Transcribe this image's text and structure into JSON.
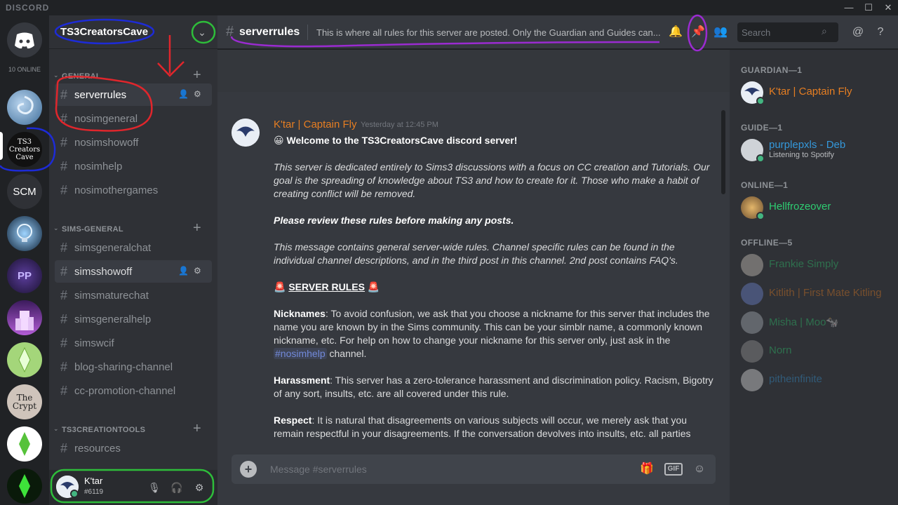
{
  "app": {
    "logo_text": "DISCORD"
  },
  "window_controls": {
    "minimize": "—",
    "maximize": "☐",
    "close": "✕"
  },
  "guilds": {
    "online_count": "10 ONLINE",
    "items": [
      {
        "name": "Discord Home",
        "label": ""
      },
      {
        "name": "Guild Blue Swirl",
        "label": ""
      },
      {
        "name": "TS3CreatorsCave",
        "label": "TS3 Creators Cave"
      },
      {
        "name": "SCM",
        "label": "SCM"
      },
      {
        "name": "Guild Lightbulb",
        "label": ""
      },
      {
        "name": "Guild PP",
        "label": "PP"
      },
      {
        "name": "Guild Castle",
        "label": ""
      },
      {
        "name": "Guild Plumbob Green",
        "label": ""
      },
      {
        "name": "The Crypt",
        "label": "The Crypt"
      },
      {
        "name": "Guild Plumbob White",
        "label": ""
      },
      {
        "name": "Guild Plumbob Dark",
        "label": ""
      }
    ]
  },
  "server": {
    "name": "TS3CreatorsCave"
  },
  "categories": [
    {
      "label": "GENERAL",
      "channels": [
        "serverrules",
        "nosimgeneral",
        "nosimshowoff",
        "nosimhelp",
        "nosimothergames"
      ]
    },
    {
      "label": "SIMS-GENERAL",
      "channels": [
        "simsgeneralchat",
        "simsshowoff",
        "simsmaturechat",
        "simsgeneralhelp",
        "simswcif",
        "blog-sharing-channel",
        "cc-promotion-channel"
      ]
    },
    {
      "label": "TS3CREATIONTOOLS",
      "channels": [
        "resources"
      ]
    }
  ],
  "user": {
    "name": "K'tar",
    "tag": "#6119"
  },
  "header": {
    "channel": "serverrules",
    "topic": "This is where all rules for this server are posted. Only the Guardian and Guides can...",
    "search_placeholder": "Search"
  },
  "message": {
    "author": "K'tar | Captain Fly",
    "timestamp": "Yesterday at 12:45 PM",
    "emoji": "😀",
    "welcome": "Welcome to the TS3CreatorsCave discord server!",
    "intro": "This server is dedicated entirely to Sims3 discussions with a focus on CC creation and Tutorials. Our goal is the spreading of knowledge about TS3 and how to create for it. Those who make a habit of creating conflict will be removed.",
    "review": "Please review these rules before making any posts.",
    "general_note": "This message contains general server-wide rules. Channel specific rules can be found in the individual channel descriptions, and in the third post in this channel. 2nd post contains FAQ's.",
    "rules_heading": "SERVER RULES",
    "siren": "🚨",
    "nicknames_label": "Nicknames",
    "nicknames_text": ": To avoid confusion, we ask that you choose a  nickname for this server that includes the name you are  known by in the Sims community. This can be your simblr  name, a commonly known nickname, etc. For help on how to  change your nickname for this server only, just ask in the",
    "nicknames_mention": "#nosimhelp",
    "nicknames_tail": " channel.",
    "harassment_label": "Harassment",
    "harassment_text": ": This server has a zero-tolerance harassment and  discrimination policy. Racism, Bigotry of any sort, insults, etc. are  all covered under this rule.",
    "respect_label": "Respect",
    "respect_text": ": It is natural that disagreements on various  subjects will occur, we merely ask that you remain  respectful in your disagreements. If the conversation  devolves into insults, etc. all parties"
  },
  "composer": {
    "placeholder": "Message #serverrules",
    "gif": "GIF"
  },
  "members": {
    "groups": [
      {
        "label": "GUARDIAN—1",
        "people": [
          {
            "name": "K'tar | Captain Fly",
            "color": "#e67e22",
            "sub": ""
          }
        ]
      },
      {
        "label": "GUIDE—1",
        "people": [
          {
            "name": "purplepxls - Deb",
            "color": "#3498db",
            "sub": "Listening to Spotify"
          }
        ]
      },
      {
        "label": "ONLINE—1",
        "people": [
          {
            "name": "Hellfrozeover",
            "color": "#2ecc71",
            "sub": ""
          }
        ]
      },
      {
        "label": "OFFLINE—5",
        "people": [
          {
            "name": "Frankie Simply",
            "color": "#2ecc71",
            "sub": ""
          },
          {
            "name": "Kitlith | First Mate Kitling",
            "color": "#e67e22",
            "sub": ""
          },
          {
            "name": "Misha | Moo🐄",
            "color": "#2ecc71",
            "sub": ""
          },
          {
            "name": "Norn",
            "color": "#2ecc71",
            "sub": ""
          },
          {
            "name": "pitheinfinite",
            "color": "#3498db",
            "sub": ""
          }
        ]
      }
    ]
  },
  "colors": {
    "annotation_red": "#e0262c",
    "annotation_green": "#2ebd3a",
    "annotation_blue": "#1d2bd6",
    "annotation_purple": "#9b2bd1"
  }
}
